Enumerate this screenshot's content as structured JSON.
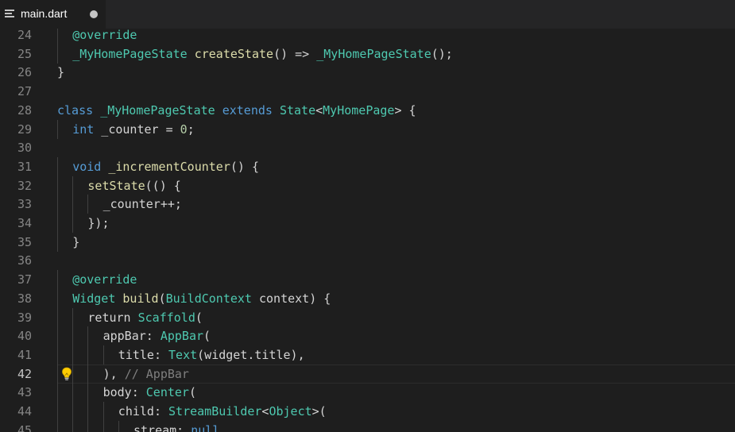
{
  "tab": {
    "filename": "main.dart",
    "icon": "file-lines-icon",
    "dirty_indicator": "unsaved-dot-icon"
  },
  "editor": {
    "current_line": 42,
    "lines": [
      {
        "num": "24",
        "indent": 1,
        "tokens": [
          {
            "t": "@override",
            "c": "an"
          }
        ]
      },
      {
        "num": "25",
        "indent": 1,
        "tokens": [
          {
            "t": "_MyHomePageState",
            "c": "ty"
          },
          {
            "t": " ",
            "c": "tx"
          },
          {
            "t": "createState",
            "c": "fn"
          },
          {
            "t": "() => ",
            "c": "tx"
          },
          {
            "t": "_MyHomePageState",
            "c": "ty"
          },
          {
            "t": "();",
            "c": "tx"
          }
        ]
      },
      {
        "num": "26",
        "indent": 0,
        "tokens": [
          {
            "t": "}",
            "c": "tx"
          }
        ]
      },
      {
        "num": "27",
        "indent": 0,
        "tokens": []
      },
      {
        "num": "28",
        "indent": 0,
        "tokens": [
          {
            "t": "class",
            "c": "kw"
          },
          {
            "t": " ",
            "c": "tx"
          },
          {
            "t": "_MyHomePageState",
            "c": "ty"
          },
          {
            "t": " ",
            "c": "tx"
          },
          {
            "t": "extends",
            "c": "kw"
          },
          {
            "t": " ",
            "c": "tx"
          },
          {
            "t": "State",
            "c": "ty"
          },
          {
            "t": "<",
            "c": "tx"
          },
          {
            "t": "MyHomePage",
            "c": "ty"
          },
          {
            "t": "> {",
            "c": "tx"
          }
        ]
      },
      {
        "num": "29",
        "indent": 1,
        "tokens": [
          {
            "t": "int",
            "c": "kw"
          },
          {
            "t": " _counter = ",
            "c": "tx"
          },
          {
            "t": "0",
            "c": "nu"
          },
          {
            "t": ";",
            "c": "tx"
          }
        ]
      },
      {
        "num": "30",
        "indent": 0,
        "tokens": []
      },
      {
        "num": "31",
        "indent": 1,
        "tokens": [
          {
            "t": "void",
            "c": "kw"
          },
          {
            "t": " ",
            "c": "tx"
          },
          {
            "t": "_incrementCounter",
            "c": "fn"
          },
          {
            "t": "() {",
            "c": "tx"
          }
        ]
      },
      {
        "num": "32",
        "indent": 2,
        "tokens": [
          {
            "t": "setState",
            "c": "fn"
          },
          {
            "t": "(() {",
            "c": "tx"
          }
        ]
      },
      {
        "num": "33",
        "indent": 3,
        "tokens": [
          {
            "t": "_counter++;",
            "c": "tx"
          }
        ]
      },
      {
        "num": "34",
        "indent": 2,
        "tokens": [
          {
            "t": "});",
            "c": "tx"
          }
        ]
      },
      {
        "num": "35",
        "indent": 1,
        "tokens": [
          {
            "t": "}",
            "c": "tx"
          }
        ]
      },
      {
        "num": "36",
        "indent": 0,
        "tokens": []
      },
      {
        "num": "37",
        "indent": 1,
        "tokens": [
          {
            "t": "@override",
            "c": "an"
          }
        ]
      },
      {
        "num": "38",
        "indent": 1,
        "tokens": [
          {
            "t": "Widget",
            "c": "ty"
          },
          {
            "t": " ",
            "c": "tx"
          },
          {
            "t": "build",
            "c": "fn"
          },
          {
            "t": "(",
            "c": "tx"
          },
          {
            "t": "BuildContext",
            "c": "ty"
          },
          {
            "t": " context) {",
            "c": "tx"
          }
        ]
      },
      {
        "num": "39",
        "indent": 2,
        "tokens": [
          {
            "t": "return",
            "c": "tx"
          },
          {
            "t": " ",
            "c": "tx"
          },
          {
            "t": "Scaffold",
            "c": "ty"
          },
          {
            "t": "(",
            "c": "tx"
          }
        ]
      },
      {
        "num": "40",
        "indent": 3,
        "tokens": [
          {
            "t": "appBar: ",
            "c": "tx"
          },
          {
            "t": "AppBar",
            "c": "ty"
          },
          {
            "t": "(",
            "c": "tx"
          }
        ]
      },
      {
        "num": "41",
        "indent": 4,
        "tokens": [
          {
            "t": "title: ",
            "c": "tx"
          },
          {
            "t": "Text",
            "c": "ty"
          },
          {
            "t": "(widget.title),",
            "c": "tx"
          }
        ]
      },
      {
        "num": "42",
        "indent": 3,
        "tokens": [
          {
            "t": "), ",
            "c": "tx"
          },
          {
            "t": "// AppBar",
            "c": "cmg"
          }
        ]
      },
      {
        "num": "43",
        "indent": 3,
        "tokens": [
          {
            "t": "body: ",
            "c": "tx"
          },
          {
            "t": "Center",
            "c": "ty"
          },
          {
            "t": "(",
            "c": "tx"
          }
        ]
      },
      {
        "num": "44",
        "indent": 4,
        "tokens": [
          {
            "t": "child: ",
            "c": "tx"
          },
          {
            "t": "StreamBuilder",
            "c": "ty"
          },
          {
            "t": "<",
            "c": "tx"
          },
          {
            "t": "Object",
            "c": "ty"
          },
          {
            "t": ">(",
            "c": "tx"
          }
        ]
      },
      {
        "num": "45",
        "indent": 5,
        "tokens": [
          {
            "t": "stream: ",
            "c": "tx"
          },
          {
            "t": "null",
            "c": "kw"
          },
          {
            "t": ",",
            "c": "tx"
          }
        ]
      }
    ],
    "lightbulb_icon": "lightbulb-icon"
  }
}
